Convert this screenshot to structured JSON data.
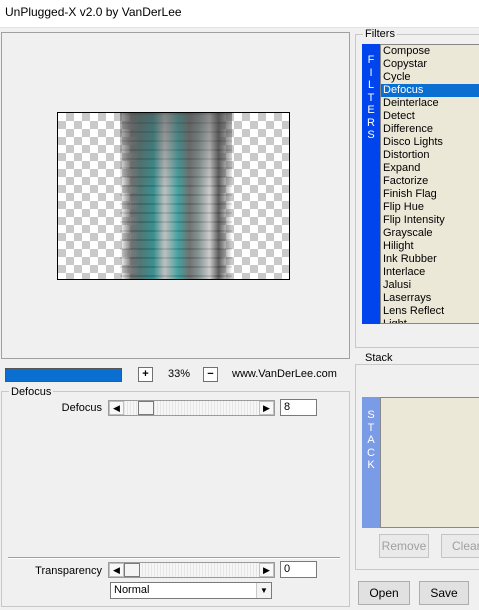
{
  "window": {
    "title": "UnPlugged-X v2.0 by VanDerLee"
  },
  "preview": {
    "zoom_level": "33%",
    "zoom_plus": "+",
    "zoom_minus": "−",
    "progress": 1.0,
    "site": "www.VanDerLee.com"
  },
  "effect": {
    "group_title": "Defocus",
    "param_label": "Defocus",
    "param_value": "8",
    "param_position": 0.12,
    "arrow_left": "◀",
    "arrow_right": "▶"
  },
  "transparency": {
    "label": "Transparency",
    "value": "0",
    "position": 0.0,
    "blend_mode": "Normal",
    "dropdown_arrow": "▼"
  },
  "filters": {
    "title": "Filters",
    "side_letters": [
      "F",
      "I",
      "L",
      "T",
      "E",
      "R",
      "S"
    ],
    "selected": "Defocus",
    "items": [
      "Compose",
      "Copystar",
      "Cycle",
      "Defocus",
      "Deinterlace",
      "Detect",
      "Difference",
      "Disco Lights",
      "Distortion",
      "Expand",
      "Factorize",
      "Finish Flag",
      "Flip Hue",
      "Flip Intensity",
      "Grayscale",
      "Hilight",
      "Ink Rubber",
      "Interlace",
      "Jalusi",
      "Laserrays",
      "Lens Reflect",
      "Light"
    ]
  },
  "stack": {
    "title": "Stack",
    "side_letters": [
      "S",
      "T",
      "A",
      "C",
      "K"
    ],
    "remove_label": "Remove",
    "clear_label": "Clear"
  },
  "actions": {
    "open_label": "Open",
    "save_label": "Save"
  },
  "colors": {
    "selection": "#0a6fd1",
    "filters_side": "#0044ee",
    "stack_side": "#7a9be6",
    "list_bg": "#ece8d8"
  }
}
